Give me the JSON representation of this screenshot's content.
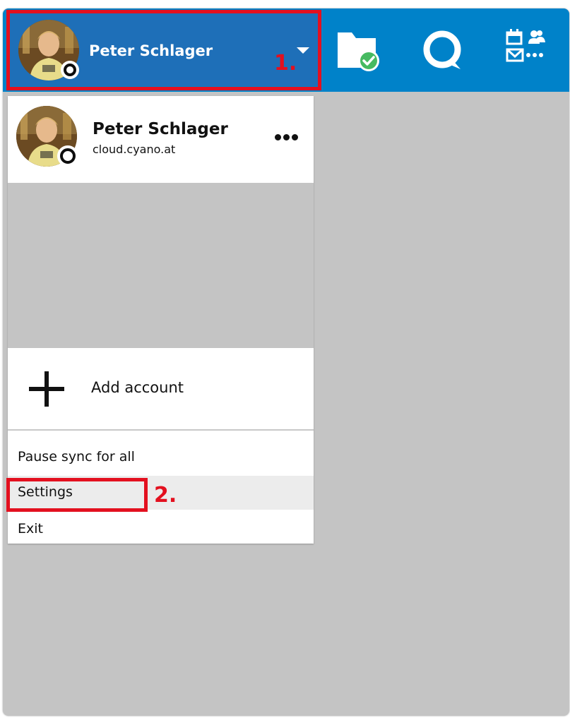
{
  "header": {
    "account_name": "Peter Schlager",
    "apps": [
      {
        "icon": "folder-sync-check-icon"
      },
      {
        "icon": "talk-icon"
      },
      {
        "icon": "apps-grid-icon"
      }
    ],
    "brand_color": "#0082c9"
  },
  "menu": {
    "account": {
      "name": "Peter Schlager",
      "server": "cloud.cyano.at"
    },
    "add_account_label": "Add account",
    "items": [
      {
        "label": "Pause sync for all"
      },
      {
        "label": "Settings"
      },
      {
        "label": "Exit"
      }
    ]
  },
  "annotations": {
    "step1": "1.",
    "step2": "2.",
    "color": "#e3101f"
  }
}
